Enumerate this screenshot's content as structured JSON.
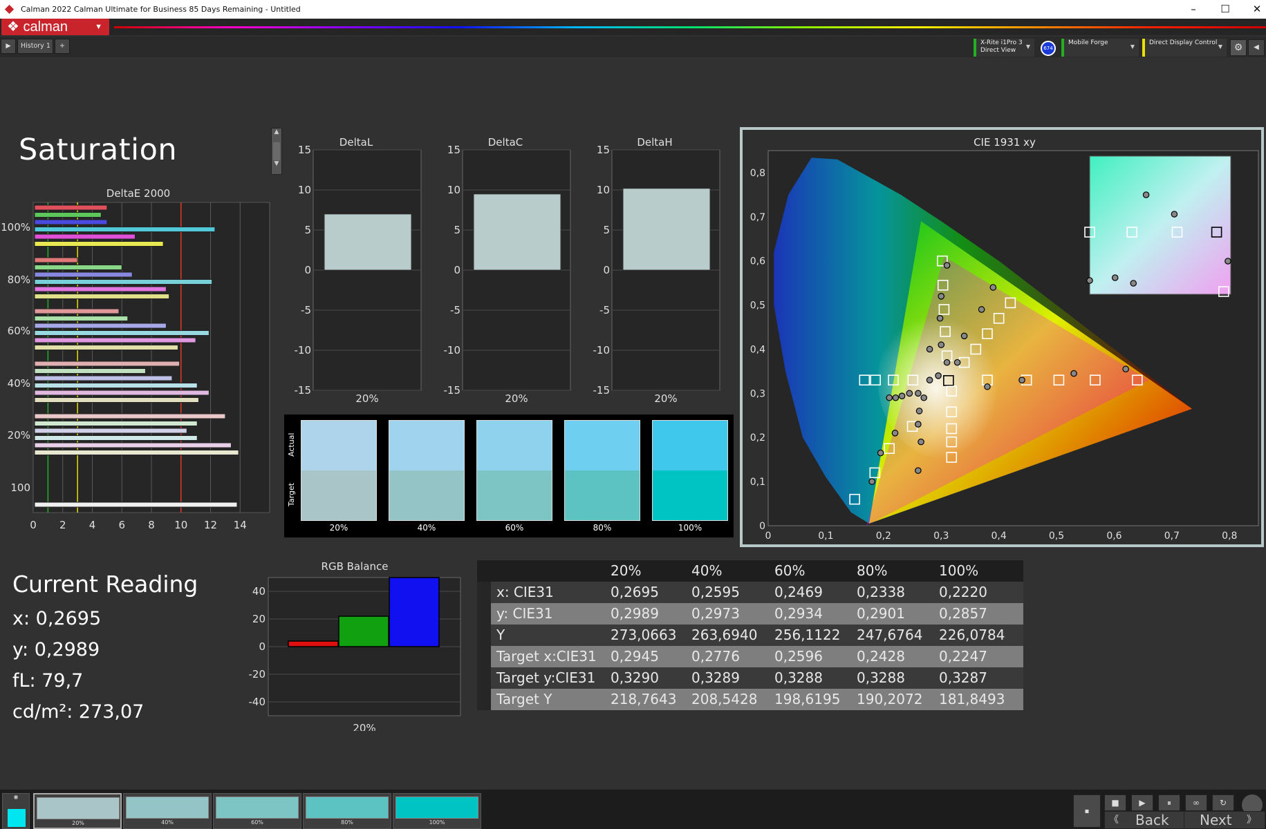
{
  "window": {
    "title": "Calman 2022 Calman Ultimate for Business 85 Days Remaining  - Untitled",
    "minimize": "–",
    "maximize": "☐",
    "close": "✕"
  },
  "app": {
    "logo": "calman"
  },
  "tabs": {
    "play": "▶",
    "history": "History 1",
    "add": "+"
  },
  "devices": {
    "meter_line1": "X-Rite i1Pro 3",
    "meter_line2": "Direct View",
    "meter_badge": "674",
    "source": "Mobile Forge",
    "display": "Direct Display Control"
  },
  "page_title": "Saturation",
  "colors": {
    "accent_red": "#c9242b",
    "meter_green": "#22b022",
    "display_yellow": "#e8e000"
  },
  "deltae": {
    "title": "DeltaE 2000",
    "x_ticks": [
      "0",
      "2",
      "4",
      "6",
      "8",
      "10",
      "12",
      "14"
    ],
    "y_labels": [
      "100%",
      "80%",
      "60%",
      "40%",
      "20%",
      "100"
    ],
    "guide_lines": [
      {
        "x": 1,
        "color": "#22b022"
      },
      {
        "x": 3,
        "color": "#e8e000"
      },
      {
        "x": 10,
        "color": "#e03a2a"
      }
    ],
    "groups": [
      {
        "label": "100%",
        "bars": [
          {
            "v": 5.0,
            "c": "#e0505a"
          },
          {
            "v": 4.6,
            "c": "#5cc85c"
          },
          {
            "v": 5.0,
            "c": "#4a4ae0"
          },
          {
            "v": 12.3,
            "c": "#50c8d8"
          },
          {
            "v": 6.9,
            "c": "#e050d8"
          },
          {
            "v": 8.8,
            "c": "#e8e850"
          }
        ]
      },
      {
        "label": "80%",
        "bars": [
          {
            "v": 3.0,
            "c": "#e07878"
          },
          {
            "v": 6.0,
            "c": "#88d888"
          },
          {
            "v": 6.7,
            "c": "#8888e0"
          },
          {
            "v": 12.1,
            "c": "#78d0d8"
          },
          {
            "v": 9.0,
            "c": "#e078e0"
          },
          {
            "v": 9.2,
            "c": "#e0e088"
          }
        ]
      },
      {
        "label": "60%",
        "bars": [
          {
            "v": 5.8,
            "c": "#e09898"
          },
          {
            "v": 6.4,
            "c": "#a8e0a8"
          },
          {
            "v": 9.0,
            "c": "#a8a8e8"
          },
          {
            "v": 11.9,
            "c": "#98d8e0"
          },
          {
            "v": 11.0,
            "c": "#e098e0"
          },
          {
            "v": 9.8,
            "c": "#e0e0a8"
          }
        ]
      },
      {
        "label": "40%",
        "bars": [
          {
            "v": 9.9,
            "c": "#e0b0b0"
          },
          {
            "v": 7.6,
            "c": "#c0e0c0"
          },
          {
            "v": 9.4,
            "c": "#c0c0e8"
          },
          {
            "v": 11.1,
            "c": "#b8e0e8"
          },
          {
            "v": 11.9,
            "c": "#e0b8e0"
          },
          {
            "v": 11.2,
            "c": "#e0e0c0"
          }
        ]
      },
      {
        "label": "20%",
        "bars": [
          {
            "v": 13.0,
            "c": "#e8c8c8"
          },
          {
            "v": 11.1,
            "c": "#d0e8d0"
          },
          {
            "v": 10.4,
            "c": "#d0d0e8"
          },
          {
            "v": 11.1,
            "c": "#d0e8e8"
          },
          {
            "v": 13.4,
            "c": "#e8d0e8"
          },
          {
            "v": 13.9,
            "c": "#e8e8d0"
          }
        ]
      },
      {
        "label": "100",
        "bars": [
          {
            "v": 13.8,
            "c": "#f0f0f0"
          }
        ]
      }
    ]
  },
  "delta_charts": {
    "y_ticks": [
      "15",
      "10",
      "5",
      "0",
      "-5",
      "-10",
      "-15"
    ],
    "xlabel": "20%",
    "charts": [
      {
        "title": "DeltaL",
        "value": 7.0
      },
      {
        "title": "DeltaC",
        "value": 9.5
      },
      {
        "title": "DeltaH",
        "value": 10.2
      }
    ]
  },
  "swatches": {
    "actual_label": "Actual",
    "target_label": "Target",
    "items": [
      {
        "label": "20%",
        "actual": "#aed4ec",
        "target": "#a9c5c8"
      },
      {
        "label": "40%",
        "actual": "#a0d4ee",
        "target": "#95c4c6"
      },
      {
        "label": "60%",
        "actual": "#8ed2ee",
        "target": "#7dc4c4"
      },
      {
        "label": "80%",
        "actual": "#6ecff0",
        "target": "#5cc2c2"
      },
      {
        "label": "100%",
        "actual": "#40c8ec",
        "target": "#00c4c4"
      }
    ]
  },
  "cie": {
    "title": "CIE 1931 xy",
    "x_ticks": [
      "0",
      "0,1",
      "0,2",
      "0,3",
      "0,4",
      "0,5",
      "0,6",
      "0,7",
      "0,8"
    ],
    "y_ticks": [
      "0,8",
      "0,7",
      "0,6",
      "0,5",
      "0,4",
      "0,3",
      "0,2",
      "0,1",
      "0"
    ],
    "targets": [
      [
        0.3127,
        0.329
      ],
      [
        0.167,
        0.33
      ],
      [
        0.186,
        0.33
      ],
      [
        0.217,
        0.33
      ],
      [
        0.251,
        0.33
      ],
      [
        0.38,
        0.33
      ],
      [
        0.448,
        0.33
      ],
      [
        0.504,
        0.33
      ],
      [
        0.567,
        0.33
      ],
      [
        0.64,
        0.33
      ],
      [
        0.302,
        0.6
      ],
      [
        0.303,
        0.545
      ],
      [
        0.305,
        0.49
      ],
      [
        0.307,
        0.44
      ],
      [
        0.31,
        0.385
      ],
      [
        0.42,
        0.505
      ],
      [
        0.4,
        0.47
      ],
      [
        0.38,
        0.435
      ],
      [
        0.36,
        0.4
      ],
      [
        0.34,
        0.37
      ],
      [
        0.318,
        0.305
      ],
      [
        0.318,
        0.258
      ],
      [
        0.318,
        0.22
      ],
      [
        0.318,
        0.19
      ],
      [
        0.318,
        0.155
      ],
      [
        0.25,
        0.225
      ],
      [
        0.21,
        0.175
      ],
      [
        0.185,
        0.12
      ],
      [
        0.15,
        0.06
      ]
    ],
    "actuals": [
      [
        0.31,
        0.59
      ],
      [
        0.3,
        0.52
      ],
      [
        0.298,
        0.47
      ],
      [
        0.3,
        0.41
      ],
      [
        0.28,
        0.4
      ],
      [
        0.31,
        0.37
      ],
      [
        0.39,
        0.54
      ],
      [
        0.37,
        0.49
      ],
      [
        0.34,
        0.43
      ],
      [
        0.328,
        0.37
      ],
      [
        0.28,
        0.33
      ],
      [
        0.295,
        0.34
      ],
      [
        0.38,
        0.315
      ],
      [
        0.44,
        0.33
      ],
      [
        0.53,
        0.345
      ],
      [
        0.62,
        0.355
      ],
      [
        0.27,
        0.29
      ],
      [
        0.26,
        0.3
      ],
      [
        0.245,
        0.3
      ],
      [
        0.232,
        0.294
      ],
      [
        0.221,
        0.29
      ],
      [
        0.21,
        0.29
      ],
      [
        0.262,
        0.26
      ],
      [
        0.26,
        0.23
      ],
      [
        0.265,
        0.19
      ],
      [
        0.22,
        0.21
      ],
      [
        0.195,
        0.165
      ],
      [
        0.18,
        0.1
      ],
      [
        0.26,
        0.125
      ]
    ],
    "zoom_targets": [
      [
        0.0,
        0.55
      ],
      [
        0.3,
        0.55
      ],
      [
        0.62,
        0.55
      ],
      [
        0.9,
        0.55
      ],
      [
        0.95,
        0.98
      ]
    ],
    "zoom_actuals": [
      [
        0.4,
        0.28
      ],
      [
        0.6,
        0.42
      ],
      [
        0.98,
        0.76
      ],
      [
        0.0,
        0.9
      ],
      [
        0.18,
        0.88
      ],
      [
        0.31,
        0.92
      ]
    ]
  },
  "current_reading": {
    "title": "Current Reading",
    "x": "x: 0,2695",
    "y": "y: 0,2989",
    "fl": "fL: 79,7",
    "cdm2": "cd/m²: 273,07"
  },
  "rgb_balance": {
    "title": "RGB Balance",
    "y_ticks": [
      "40",
      "20",
      "0",
      "-20",
      "-40"
    ],
    "xlabel": "20%",
    "values": [
      {
        "v": 4,
        "c": "#e01010"
      },
      {
        "v": 22,
        "c": "#10a010"
      },
      {
        "v": 50,
        "c": "#1010f0"
      }
    ]
  },
  "table": {
    "headers": [
      "",
      "20%",
      "40%",
      "60%",
      "80%",
      "100%"
    ],
    "rows": [
      [
        "x: CIE31",
        "0,2695",
        "0,2595",
        "0,2469",
        "0,2338",
        "0,2220"
      ],
      [
        "y: CIE31",
        "0,2989",
        "0,2973",
        "0,2934",
        "0,2901",
        "0,2857"
      ],
      [
        "Y",
        "273,0663",
        "263,6940",
        "256,1122",
        "247,6764",
        "226,0784"
      ],
      [
        "Target x:CIE31",
        "0,2945",
        "0,2776",
        "0,2596",
        "0,2428",
        "0,2247"
      ],
      [
        "Target y:CIE31",
        "0,3290",
        "0,3289",
        "0,3288",
        "0,3288",
        "0,3287"
      ],
      [
        "Target Y",
        "218,7643",
        "208,5428",
        "198,6195",
        "190,2072",
        "181,8493"
      ]
    ]
  },
  "bottom": {
    "thumbs": [
      {
        "label": "20%",
        "color": "#a9c5c8"
      },
      {
        "label": "40%",
        "color": "#95c4c6"
      },
      {
        "label": "60%",
        "color": "#7dc4c4"
      },
      {
        "label": "80%",
        "color": "#5cc2c2"
      },
      {
        "label": "100%",
        "color": "#00c4c4"
      }
    ],
    "current_color": "#00e6f0",
    "back": "Back",
    "next": "Next"
  }
}
